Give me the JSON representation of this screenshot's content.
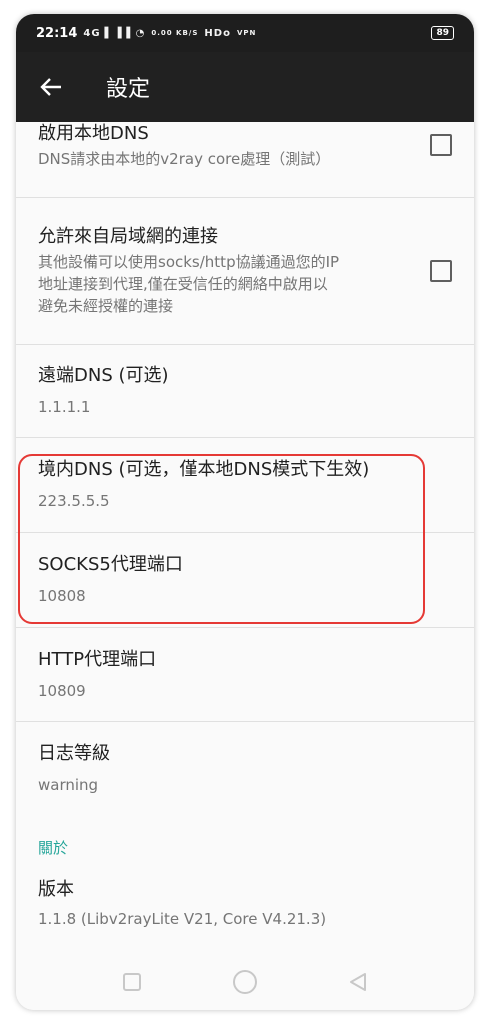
{
  "status_bar": {
    "time": "22:14",
    "signal_icons": "4G⁠ ▐▐ 4G ▐▐ WiFi",
    "net_speed": "0.00 KB/S",
    "hd": "HDo",
    "vpn": "VPN",
    "battery": "89"
  },
  "toolbar": {
    "back_icon": "arrow-left-icon",
    "title": "設定"
  },
  "settings": {
    "local_dns": {
      "title": "啟用本地DNS",
      "summary": "DNS請求由本地的v2ray core處理（測試）",
      "checked": false
    },
    "lan_connections": {
      "title": "允許來自局域網的連接",
      "summary_line1": "其他設備可以使用socks/http協議通過您的IP",
      "summary_line2": "地址連接到代理,僅在受信任的網絡中啟用以",
      "summary_line3": "避免未經授權的連接",
      "checked": false
    },
    "remote_dns": {
      "title": "遠端DNS (可选)",
      "value": "1.1.1.1"
    },
    "domestic_dns": {
      "title": "境内DNS (可选，僅本地DNS模式下生效)",
      "value": "223.5.5.5"
    },
    "socks_port": {
      "title": "SOCKS5代理端口",
      "value": "10808"
    },
    "http_port": {
      "title": "HTTP代理端口",
      "value": "10809"
    },
    "log_level": {
      "title": "日志等級",
      "value": "warning"
    }
  },
  "about": {
    "header": "關於",
    "version_title": "版本",
    "version_value": "1.1.8 (Libv2rayLite V21, Core V4.21.3)"
  },
  "nav_bar": {
    "recent_icon": "square-icon",
    "home_icon": "circle-icon",
    "back_icon": "triangle-back-icon"
  },
  "colors": {
    "toolbar": "#212121",
    "accent": "#26a69a",
    "highlight": "#e53935"
  }
}
